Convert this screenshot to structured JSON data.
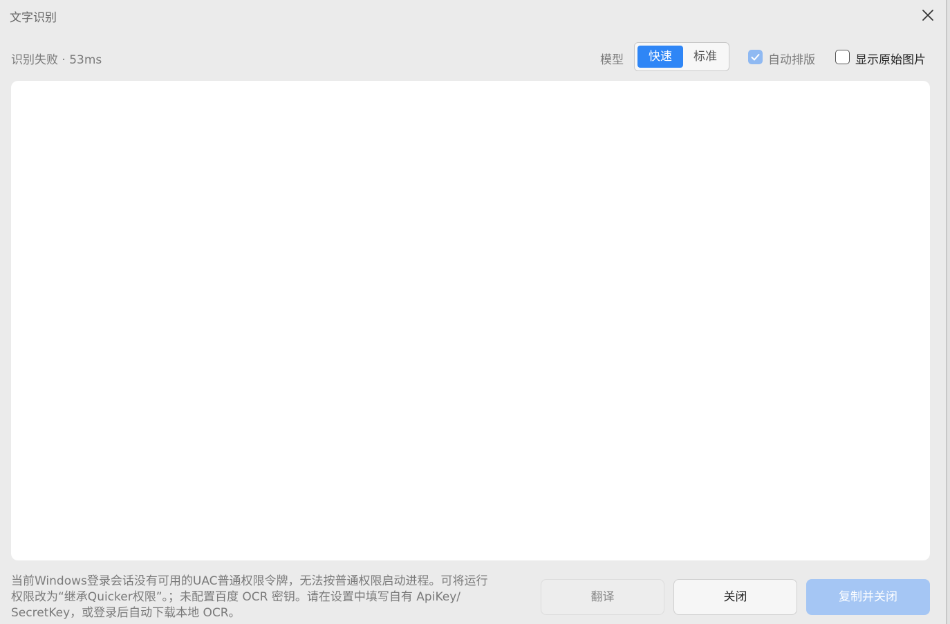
{
  "window": {
    "title": "文字识别",
    "close_icon": "close-icon"
  },
  "toolbar": {
    "status": "识别失败 · 53ms",
    "model_label": "模型",
    "model_options": [
      "快速",
      "标准"
    ],
    "model_selected": "快速",
    "auto_layout_label": "自动排版",
    "auto_layout_checked": true,
    "show_original_label": "显示原始图片",
    "show_original_checked": false
  },
  "result": {
    "text": ""
  },
  "footer": {
    "message_lines": [
      "当前Windows登录会话没有可用的UAC普通权限令牌，无法按普通权限启动进程。可将运行",
      "权限改为“继承Quicker权限”。；未配置百度 OCR 密钥。请在设置中填写自有 ApiKey/",
      "SecretKey，或登录后自动下载本地 OCR。"
    ],
    "translate_label": "翻译",
    "close_label": "关闭",
    "copy_close_label": "复制并关闭"
  },
  "colors": {
    "accent": "#2f86f6",
    "accent_light": "#a5c6f4",
    "background": "#ebebeb"
  }
}
